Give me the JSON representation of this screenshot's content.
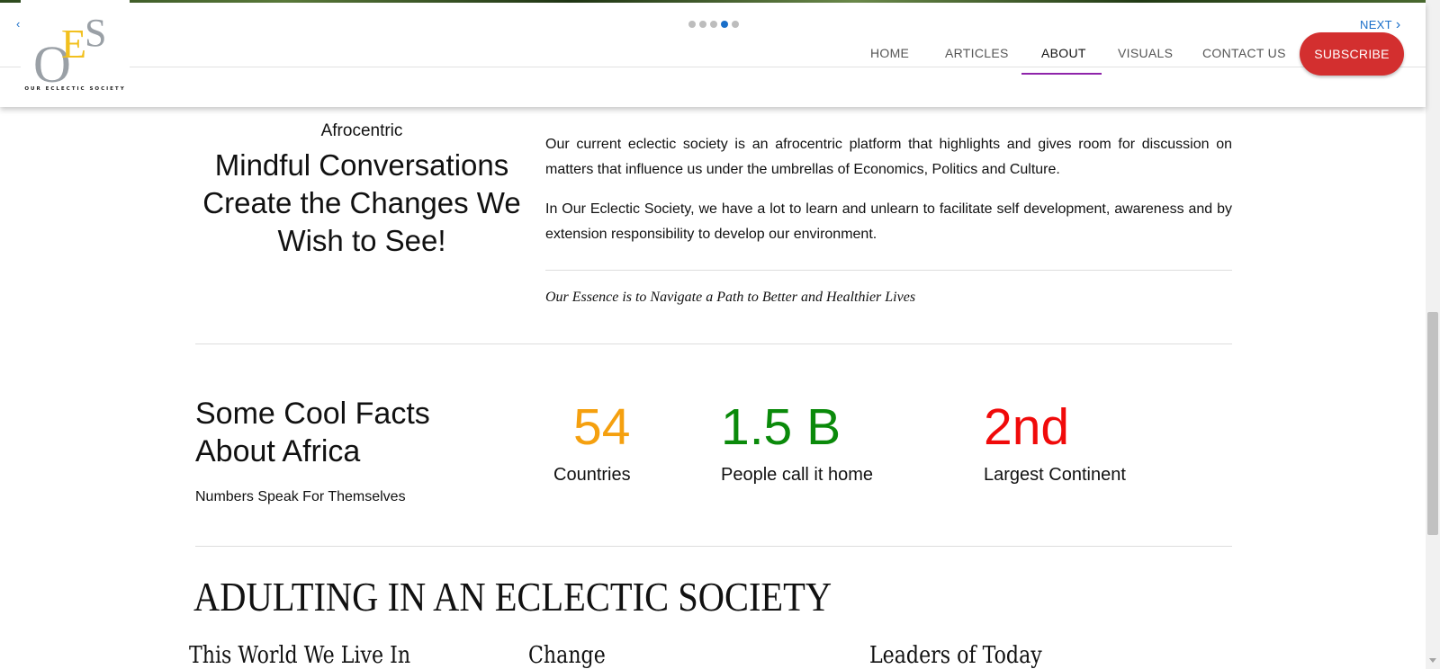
{
  "header": {
    "prev_arrow": "‹",
    "next_label": "NEXT",
    "next_chevron": "›",
    "slider_dot_count": 5,
    "slider_active_dot": 4,
    "logo_letters": "OES",
    "logo_caption": "OUR ECLECTIC SOCIETY",
    "nav": [
      {
        "label": "HOME"
      },
      {
        "label": "ARTICLES"
      },
      {
        "label": "ABOUT"
      },
      {
        "label": "VISUALS"
      },
      {
        "label": "CONTACT US"
      }
    ],
    "active_nav": "ABOUT",
    "subscribe_label": "SUBSCRIBE"
  },
  "about": {
    "eyebrow": "Afrocentric",
    "headline": "Mindful Conversations Create the Changes We Wish to See!",
    "paragraph1": "Our current eclectic society is an afrocentric platform that highlights and gives room for discussion on matters that influence us under the umbrellas of Economics, Politics and Culture.",
    "paragraph2": "In Our Eclectic Society, we have a lot to learn and unlearn to facilitate self development, awareness and by extension responsibility to develop our environment.",
    "essence": "Our Essence is to Navigate a Path to Better and Healthier Lives"
  },
  "facts": {
    "title": "Some Cool Facts About Africa",
    "subtitle": "Numbers Speak For Themselves",
    "stats": [
      {
        "value": "54",
        "label": "Countries",
        "color": "#f5a00f"
      },
      {
        "value": "1.5 B",
        "label": "People call it home",
        "color": "#0a8a0a"
      },
      {
        "value": "2nd",
        "label": "Largest Continent",
        "color": "#f00a0a"
      }
    ]
  },
  "adulting": {
    "title": "ADULTING IN AN ECLECTIC SOCIETY",
    "columns": [
      {
        "title": "This World We Live In"
      },
      {
        "title": "Change"
      },
      {
        "title": "Leaders of Today"
      }
    ]
  },
  "colors": {
    "accent_blue": "#1a6fc9",
    "subscribe_red": "#d32f2f",
    "active_underline": "#8e24aa",
    "logo_gold": "#f2c01e",
    "logo_grey": "#9aa0a6"
  }
}
